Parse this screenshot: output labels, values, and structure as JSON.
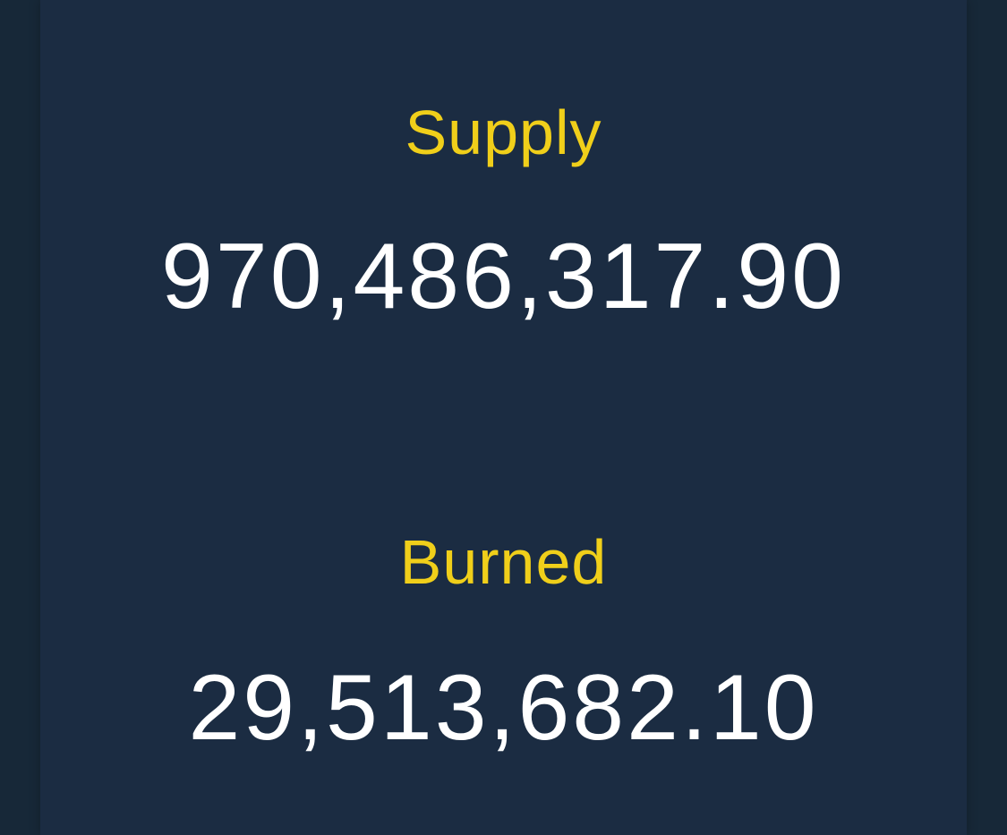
{
  "stats": {
    "supply": {
      "label": "Supply",
      "value": "970,486,317.90"
    },
    "burned": {
      "label": "Burned",
      "value": "29,513,682.10"
    }
  },
  "colors": {
    "label": "#f0cf1a",
    "value": "#ffffff",
    "panel": "#1b2c42",
    "background": "#172838"
  }
}
